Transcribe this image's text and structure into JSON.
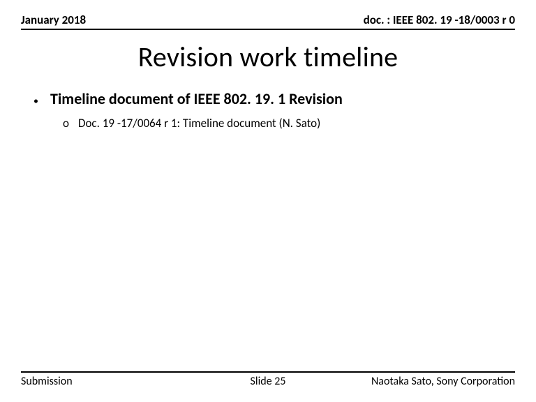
{
  "header": {
    "date": "January 2018",
    "doc": "doc. : IEEE 802. 19 -18/0003 r 0"
  },
  "title": "Revision work timeline",
  "content": {
    "bullet1": {
      "marker": "•",
      "text": "Timeline document of IEEE 802. 19. 1 Revision"
    },
    "bullet2": {
      "marker": "o",
      "text": "Doc. 19 -17/0064 r 1: Timeline document (N. Sato)"
    }
  },
  "footer": {
    "left": "Submission",
    "center": "Slide 25",
    "right": "Naotaka Sato, Sony Corporation"
  }
}
